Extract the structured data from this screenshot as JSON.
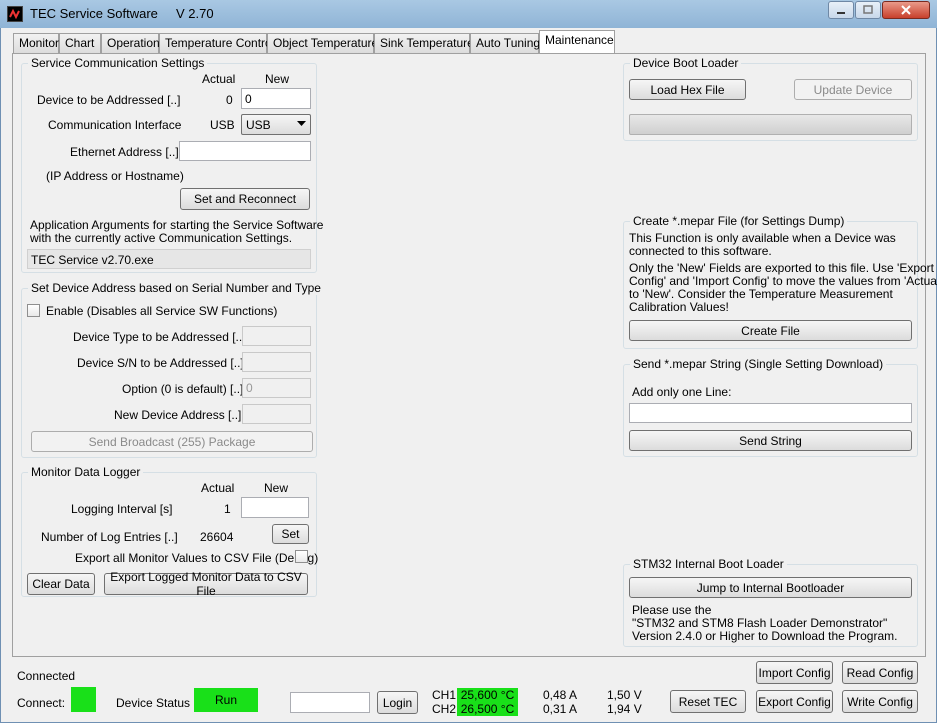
{
  "window": {
    "title": "TEC Service Software",
    "version": "V 2.70"
  },
  "tabs": [
    "Monitor",
    "Chart",
    "Operation",
    "Temperature Control",
    "Object Temperature",
    "Sink Temperature",
    "Auto Tuning",
    "Maintenance"
  ],
  "comm": {
    "title": "Service Communication Settings",
    "col_actual": "Actual",
    "col_new": "New",
    "device_label": "Device to be Addressed [..]",
    "device_actual": "0",
    "device_new": "0",
    "iface_label": "Communication Interface",
    "iface_actual": "USB",
    "iface_new": "USB",
    "eth_label": "Ethernet Address [..]",
    "eth_value": "",
    "ip_label": "(IP Address or Hostname)",
    "reconnect": "Set and Reconnect",
    "args_line1": "Application Arguments for starting the Service Software",
    "args_line2": "with the currently active Communication Settings.",
    "args_value": "TEC Service v2.70.exe"
  },
  "serial": {
    "title": "Set Device Address based on Serial Number and Type",
    "enable": "Enable (Disables all Service SW Functions)",
    "type_label": "Device Type to be Addressed [..]",
    "type_value": "",
    "sn_label": "Device S/N to be Addressed [..]",
    "sn_value": "",
    "opt_label": "Option (0 is default) [..]",
    "opt_value": "0",
    "addr_label": "New Device Address [..]",
    "addr_value": "",
    "broadcast": "Send Broadcast (255) Package"
  },
  "logger": {
    "title": "Monitor Data Logger",
    "col_actual": "Actual",
    "col_new": "New",
    "interval_label": "Logging Interval [s]",
    "interval_actual": "1",
    "interval_new": "",
    "entries_label": "Number of Log Entries [..]",
    "entries_value": "26604",
    "set": "Set",
    "export_csv_label": "Export all Monitor Values to CSV File (Debug)",
    "clear": "Clear Data",
    "export": "Export Logged Monitor Data to CSV File"
  },
  "boot": {
    "title": "Device Boot Loader",
    "load": "Load Hex File",
    "update": "Update Device"
  },
  "mepar": {
    "title": "Create *.mepar File (for Settings Dump)",
    "l1": "This Function is only available when a Device was",
    "l2": "connected to this software.",
    "l3": "Only the 'New' Fields are exported to this file. Use 'Export",
    "l4": "Config' and 'Import Config' to move the values from 'Actual'",
    "l5": "to 'New'. Consider the Temperature Measurement",
    "l6": "Calibration Values!",
    "create": "Create File"
  },
  "sendstr": {
    "title": "Send *.mepar String (Single Setting Download)",
    "hint": "Add only one Line:",
    "value": "",
    "send": "Send String"
  },
  "stm": {
    "title": "STM32 Internal Boot Loader",
    "jump": "Jump to Internal Bootloader",
    "l1": "Please use the",
    "l2": "\"STM32 and STM8 Flash Loader Demonstrator\"",
    "l3": "Version 2.4.0 or Higher to Download the Program."
  },
  "status": {
    "connected": "Connected",
    "connect_label": "Connect:",
    "device_status_label": "Device Status",
    "device_status": "Run",
    "password": "",
    "login": "Login",
    "ch1": "CH1",
    "ch1_temp": "25,600 °C",
    "ch1_current": "0,48 A",
    "ch1_voltage": "1,50 V",
    "ch2": "CH2",
    "ch2_temp": "26,500 °C",
    "ch2_current": "0,31 A",
    "ch2_voltage": "1,94 V",
    "reset": "Reset TEC",
    "import": "Import Config",
    "export": "Export Config",
    "read": "Read Config",
    "write": "Write Config"
  },
  "colors": {
    "status_green": "#19e019",
    "accent": "#3c7fb1"
  }
}
